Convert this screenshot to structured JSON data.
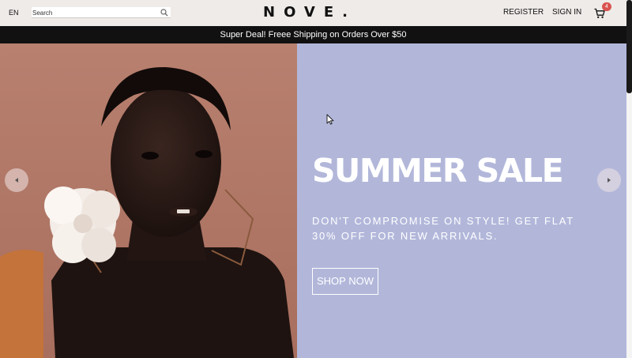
{
  "navbar": {
    "language": "EN",
    "search": {
      "placeholder": "Search",
      "value": ""
    },
    "logo": "NOVE.",
    "register_label": "REGISTER",
    "signin_label": "SIGN IN",
    "cart_count": "4"
  },
  "announcement": {
    "text": "Super Deal! Freee Shipping on Orders Over $50"
  },
  "slider": {
    "title": "SUMMER SALE",
    "description": "DON'T COMPROMISE ON STYLE! GET FLAT 30% OFF FOR NEW ARRIVALS.",
    "button_label": "SHOP NOW",
    "background": "#b2b7da",
    "image_background": "#b7806f"
  },
  "icons": {
    "search": "search-icon",
    "cart": "cart-icon",
    "previous": "arrow-left-icon",
    "next": "arrow-right-icon"
  },
  "colors": {
    "navbar": "#eeebe8",
    "announcement": "#111111",
    "badge": "#d9534f",
    "accent_text": "#ffffff"
  }
}
